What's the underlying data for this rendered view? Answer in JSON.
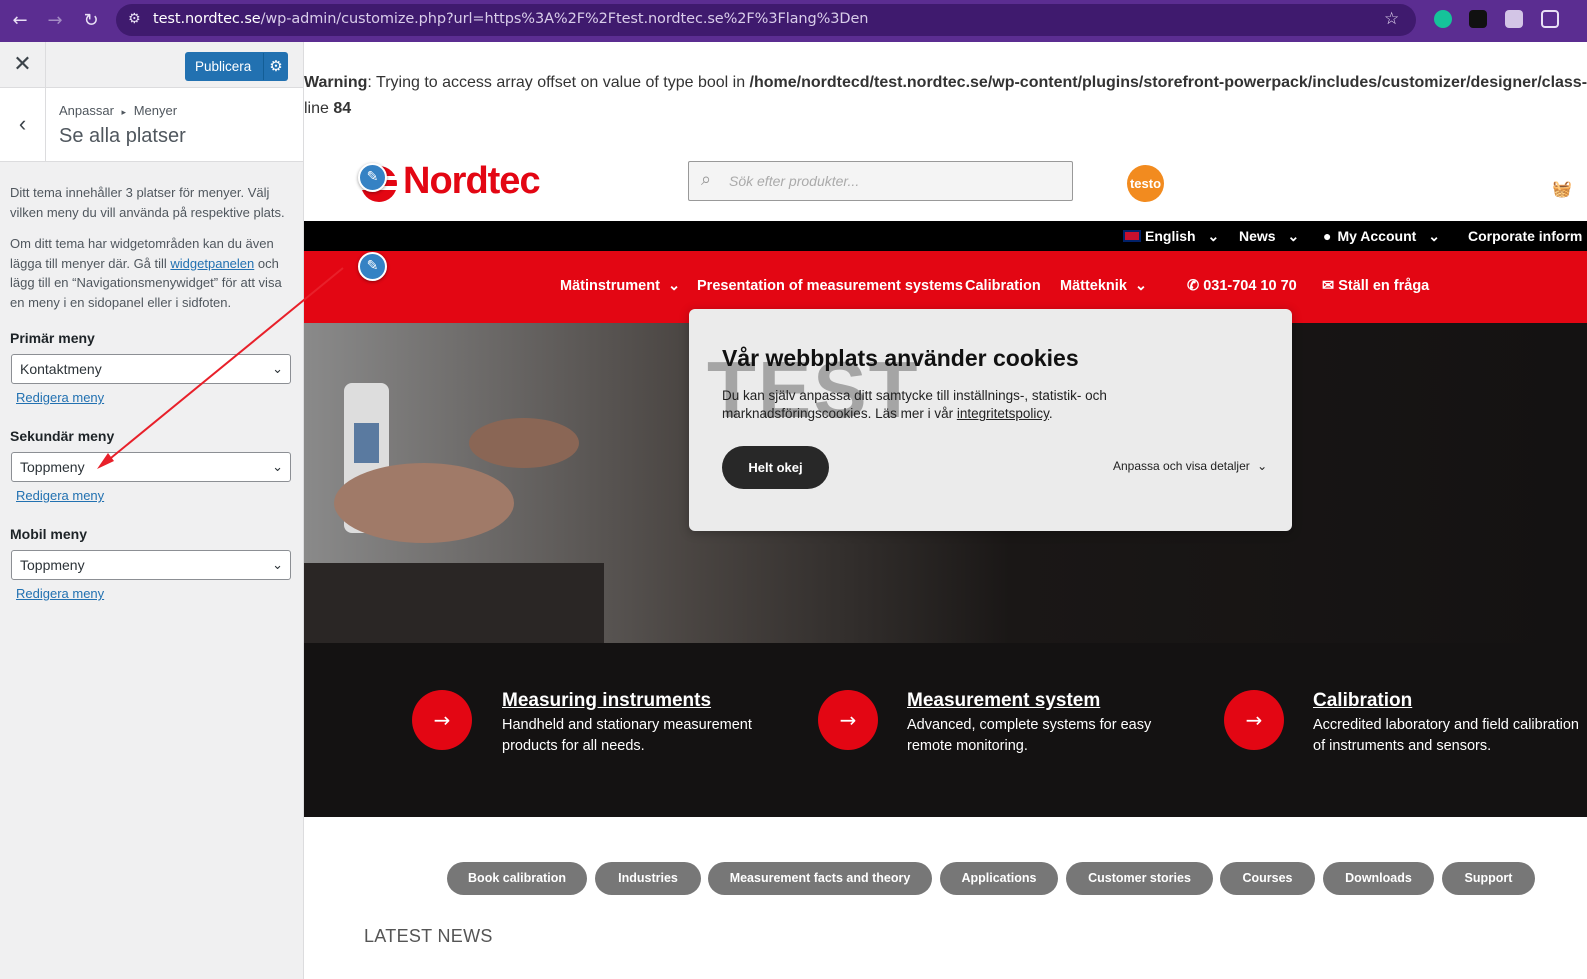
{
  "browser": {
    "url_domain": "test.nordtec.se",
    "url_path": "/wp-admin/customize.php?url=https%3A%2F%2Ftest.nordtec.se%2F%3Flang%3Den"
  },
  "sidebar": {
    "publish_label": "Publicera",
    "breadcrumb_parent": "Anpassar",
    "breadcrumb_sep": "▸",
    "breadcrumb_child": "Menyer",
    "section_title": "Se alla platser",
    "desc1": "Ditt tema innehåller 3 platser för menyer. Välj vilken meny du vill använda på respektive plats.",
    "desc2_pre": "Om ditt tema har widgetområden kan du även lägga till menyer där. Gå till ",
    "desc2_link": "widgetpanelen",
    "desc2_post": " och lägg till en “Navigationsmenywidget” för att visa en meny i en sidopanel eller i sidfoten.",
    "locations": [
      {
        "label": "Primär meny",
        "value": "Kontaktmeny",
        "edit": "Redigera meny"
      },
      {
        "label": "Sekundär meny",
        "value": "Toppmeny",
        "edit": "Redigera meny"
      },
      {
        "label": "Mobil meny",
        "value": "Toppmeny",
        "edit": "Redigera meny"
      }
    ]
  },
  "site": {
    "warning_label": "Warning",
    "warning_text": ": Trying to access array offset on value of type bool in ",
    "warning_path": "/home/nordtecd/test.nordtec.se/wp-content/plugins/storefront-powerpack/includes/customizer/designer/class-sp-c",
    "warning_line_label": "line ",
    "warning_line": "84",
    "logo_text": "Nordtec",
    "search_placeholder": "Sök efter produkter...",
    "testo_logo": "testo",
    "topbar": {
      "language": "English",
      "news": "News",
      "account": "My Account",
      "corporate": "Corporate inform"
    },
    "mainnav": [
      "Mätinstrument",
      "Presentation of measurement systems",
      "Calibration",
      "Mätteknik"
    ],
    "phone": "031-704 10 70",
    "ask": "Ställ en fråga",
    "cookie": {
      "title": "Vår webbplats använder cookies",
      "watermark": "TEST",
      "text_pre": "Du kan själv anpassa ditt samtycke till inställnings-, statistik- och marknadsföringscookies. Läs mer i vår ",
      "text_link": "integritetspolicy",
      "text_post": ".",
      "accept": "Helt okej",
      "details": "Anpassa och visa detaljer"
    },
    "features": [
      {
        "title": "Measuring instruments",
        "text": "Handheld and stationary measurement products for all needs."
      },
      {
        "title": "Measurement system",
        "text": "Advanced, complete systems for easy remote monitoring."
      },
      {
        "title": "Calibration",
        "text": "Accredited laboratory and field calibration of instruments and sensors."
      }
    ],
    "pills": [
      "Book calibration",
      "Industries",
      "Measurement facts and theory",
      "Applications",
      "Customer stories",
      "Courses",
      "Downloads",
      "Support"
    ],
    "latest_news": "LATEST NEWS"
  },
  "colors": {
    "brand_red": "#e30613",
    "wp_blue": "#2271b1",
    "browser_purple": "#5b2d91"
  }
}
